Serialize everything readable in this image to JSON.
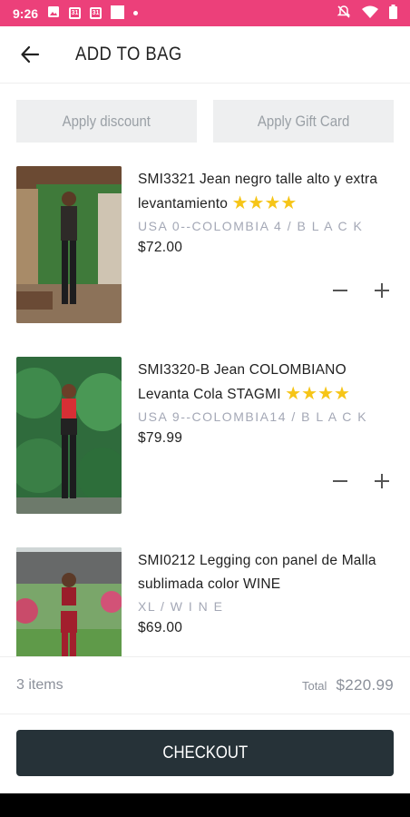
{
  "status_bar": {
    "time": "9:26",
    "calendar_a": "31",
    "calendar_b": "31"
  },
  "header": {
    "title": "ADD TO BAG"
  },
  "actions": {
    "discount_label": "Apply discount",
    "gift_card_label": "Apply Gift Card"
  },
  "cart": {
    "items": [
      {
        "title": "SMI3321 Jean negro talle alto y extra levantamiento",
        "stars": "★★★★",
        "variant": "USA 0--COLOMBIA 4 / B L A C K",
        "price": "$72.00"
      },
      {
        "title": "SMI3320-B Jean COLOMBIANO Levanta Cola STAGMI",
        "stars": "★★★★",
        "variant": "USA 9--COLOMBIA14 / B L A C K",
        "price": "$79.99"
      },
      {
        "title": "SMI0212 Legging con panel de Malla sublimada color WINE",
        "stars": "",
        "variant": "XL / W I N E",
        "price": "$69.00"
      }
    ]
  },
  "summary": {
    "count": "3 items",
    "total_label": "Total",
    "total_value": "$220.99"
  },
  "checkout": {
    "label": "CHECKOUT"
  },
  "colors": {
    "status_bar": "#ec407a",
    "checkout_bg": "#263238",
    "star": "#f6c518",
    "variant_text": "#a4a8b6"
  }
}
